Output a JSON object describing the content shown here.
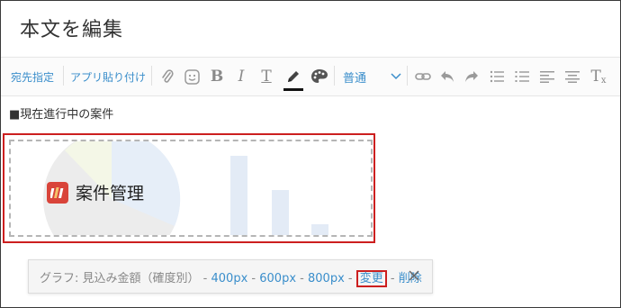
{
  "page": {
    "title": "本文を編集"
  },
  "toolbar": {
    "recipient_label": "宛先指定",
    "app_paste_label": "アプリ貼り付け",
    "bold_glyph": "B",
    "italic_glyph": "I",
    "text_color_glyph": "T",
    "format_label": "普通",
    "clear_format_glyph": "T"
  },
  "editor": {
    "text": "■現在進行中の案件",
    "embed": {
      "app_name": "案件管理"
    }
  },
  "graph_bar": {
    "label": "グラフ: 見込み金額（確度別）",
    "size_small": "400px",
    "size_medium": "600px",
    "size_large": "800px",
    "separator": "-",
    "change_label": "変更",
    "delete_label": "削除"
  },
  "colors": {
    "link": "#3a8ecb",
    "highlight_box": "#cc1f1f",
    "app_icon": "#d9443a"
  }
}
